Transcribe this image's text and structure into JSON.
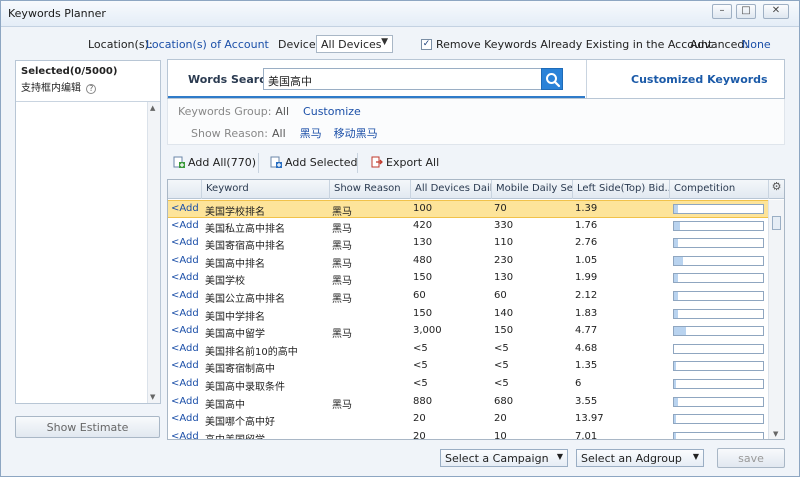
{
  "window": {
    "title": "Keywords Planner"
  },
  "topbar": {
    "location_label": "Location(s):",
    "location_link": "Location(s) of Account",
    "device_label": "Device:",
    "device_value": "All Devices",
    "remove_existing_label": "Remove Keywords Already Existing in the Account",
    "remove_existing_checked": true,
    "advanced_label": "Advanced:",
    "advanced_value": "None"
  },
  "left_panel": {
    "selected_label": "Selected(0/5000)",
    "sub_label": "支持框内编辑",
    "help_icon": "?",
    "show_estimate": "Show Estimate"
  },
  "search": {
    "tab_label": "Words Search",
    "value": "美国高中",
    "custom_tab_label": "Customized Keywords"
  },
  "filters": {
    "group_label": "Keywords Group:",
    "group_value": "All",
    "group_action": "Customize",
    "reason_label": "Show Reason:",
    "reason_value": "All",
    "reason_options": [
      "黑马",
      "移动黑马"
    ]
  },
  "toolbar": {
    "add_all": "Add All(770)",
    "add_selected": "Add Selected",
    "export_all": "Export All"
  },
  "table": {
    "columns": [
      "Keyword",
      "Show Reason",
      "All Devices Dail...",
      "Mobile Daily Se...",
      "Left Side(Top) Bid...",
      "Competition"
    ],
    "add_label": "<Add",
    "rows": [
      {
        "keyword": "美国学校排名",
        "reason": "黑马",
        "all": "100",
        "mobile": "70",
        "bid": "1.39",
        "competition": 0.04,
        "selected": true
      },
      {
        "keyword": "美国私立高中排名",
        "reason": "黑马",
        "all": "420",
        "mobile": "330",
        "bid": "1.76",
        "competition": 0.07
      },
      {
        "keyword": "美国寄宿高中排名",
        "reason": "黑马",
        "all": "130",
        "mobile": "110",
        "bid": "2.76",
        "competition": 0.04
      },
      {
        "keyword": "美国高中排名",
        "reason": "黑马",
        "all": "480",
        "mobile": "230",
        "bid": "1.05",
        "competition": 0.1
      },
      {
        "keyword": "美国学校",
        "reason": "黑马",
        "all": "150",
        "mobile": "130",
        "bid": "1.99",
        "competition": 0.04
      },
      {
        "keyword": "美国公立高中排名",
        "reason": "黑马",
        "all": "60",
        "mobile": "60",
        "bid": "2.12",
        "competition": 0.04
      },
      {
        "keyword": "美国中学排名",
        "reason": "",
        "all": "150",
        "mobile": "140",
        "bid": "1.83",
        "competition": 0.04
      },
      {
        "keyword": "美国高中留学",
        "reason": "黑马",
        "all": "3,000",
        "mobile": "150",
        "bid": "4.77",
        "competition": 0.14
      },
      {
        "keyword": "美国排名前10的高中",
        "reason": "",
        "all": "<5",
        "mobile": "<5",
        "bid": "4.68",
        "competition": 0.0
      },
      {
        "keyword": "美国寄宿制高中",
        "reason": "",
        "all": "<5",
        "mobile": "<5",
        "bid": "1.35",
        "competition": 0.02
      },
      {
        "keyword": "美国高中录取条件",
        "reason": "",
        "all": "<5",
        "mobile": "<5",
        "bid": "6",
        "competition": 0.02
      },
      {
        "keyword": "美国高中",
        "reason": "黑马",
        "all": "880",
        "mobile": "680",
        "bid": "3.55",
        "competition": 0.04
      },
      {
        "keyword": "美国哪个高中好",
        "reason": "",
        "all": "20",
        "mobile": "20",
        "bid": "13.97",
        "competition": 0.02
      },
      {
        "keyword": "高中美国留学",
        "reason": "",
        "all": "20",
        "mobile": "10",
        "bid": "7.01",
        "competition": 0.02
      }
    ]
  },
  "bottom": {
    "campaign_placeholder": "Select a Campaign",
    "adgroup_placeholder": "Select an Adgroup",
    "save": "save"
  }
}
